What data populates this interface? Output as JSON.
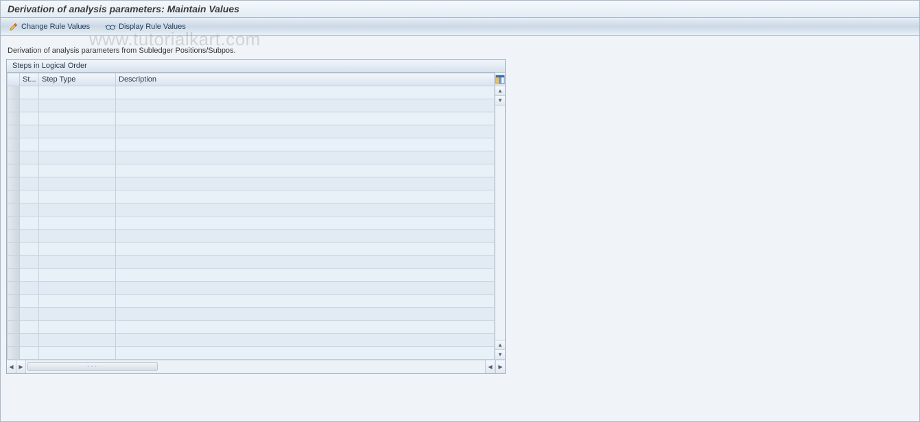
{
  "title": "Derivation of analysis parameters: Maintain Values",
  "toolbar": {
    "change_label": "Change Rule Values",
    "display_label": "Display Rule Values"
  },
  "subtitle": "Derivation of analysis parameters from Subledger Positions/Subpos.",
  "grid": {
    "caption": "Steps in Logical Order",
    "columns": {
      "st": "St...",
      "step_type": "Step Type",
      "description": "Description"
    },
    "rows": [
      {
        "st": "",
        "step_type": "",
        "description": ""
      },
      {
        "st": "",
        "step_type": "",
        "description": ""
      },
      {
        "st": "",
        "step_type": "",
        "description": ""
      },
      {
        "st": "",
        "step_type": "",
        "description": ""
      },
      {
        "st": "",
        "step_type": "",
        "description": ""
      },
      {
        "st": "",
        "step_type": "",
        "description": ""
      },
      {
        "st": "",
        "step_type": "",
        "description": ""
      },
      {
        "st": "",
        "step_type": "",
        "description": ""
      },
      {
        "st": "",
        "step_type": "",
        "description": ""
      },
      {
        "st": "",
        "step_type": "",
        "description": ""
      },
      {
        "st": "",
        "step_type": "",
        "description": ""
      },
      {
        "st": "",
        "step_type": "",
        "description": ""
      },
      {
        "st": "",
        "step_type": "",
        "description": ""
      },
      {
        "st": "",
        "step_type": "",
        "description": ""
      },
      {
        "st": "",
        "step_type": "",
        "description": ""
      },
      {
        "st": "",
        "step_type": "",
        "description": ""
      },
      {
        "st": "",
        "step_type": "",
        "description": ""
      },
      {
        "st": "",
        "step_type": "",
        "description": ""
      },
      {
        "st": "",
        "step_type": "",
        "description": ""
      },
      {
        "st": "",
        "step_type": "",
        "description": ""
      },
      {
        "st": "",
        "step_type": "",
        "description": ""
      }
    ]
  },
  "watermark": "www.tutorialkart.com"
}
